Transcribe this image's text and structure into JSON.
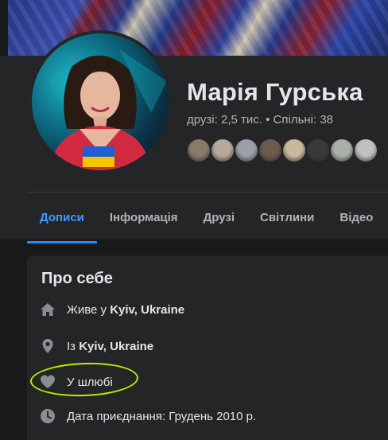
{
  "profile": {
    "name": "Марія Гурська",
    "friends_label": "друзі:",
    "friends_count": "2,5 тис.",
    "separator": "•",
    "mutual_label": "Спільні:",
    "mutual_count": "38",
    "mutual_avatar_colors": [
      "#8a7a6a",
      "#b8a89a",
      "#9aa0a8",
      "#6b5a4e",
      "#c8b89c",
      "#3a3a3a",
      "#a8b0a8",
      "#c0c0c0"
    ]
  },
  "tabs": [
    {
      "label": "Дописи",
      "active": true
    },
    {
      "label": "Інформація",
      "active": false
    },
    {
      "label": "Друзі",
      "active": false
    },
    {
      "label": "Світлини",
      "active": false
    },
    {
      "label": "Відео",
      "active": false
    }
  ],
  "about": {
    "title": "Про себе",
    "lives_prefix": "Живе у",
    "lives_place": "Kyiv, Ukraine",
    "from_prefix": "Із",
    "from_place": "Kyiv, Ukraine",
    "relationship": "У шлюбі",
    "joined": "Дата приєднання: Грудень 2010 р."
  },
  "icons": {
    "home": "home-icon",
    "location": "location-pin-icon",
    "relationship": "heart-icon",
    "clock": "clock-icon"
  },
  "colors": {
    "background": "#18191a",
    "card": "#242526",
    "accent": "#2d88ff",
    "highlight": "#b9f000",
    "secondary_text": "#b0b3b8"
  }
}
